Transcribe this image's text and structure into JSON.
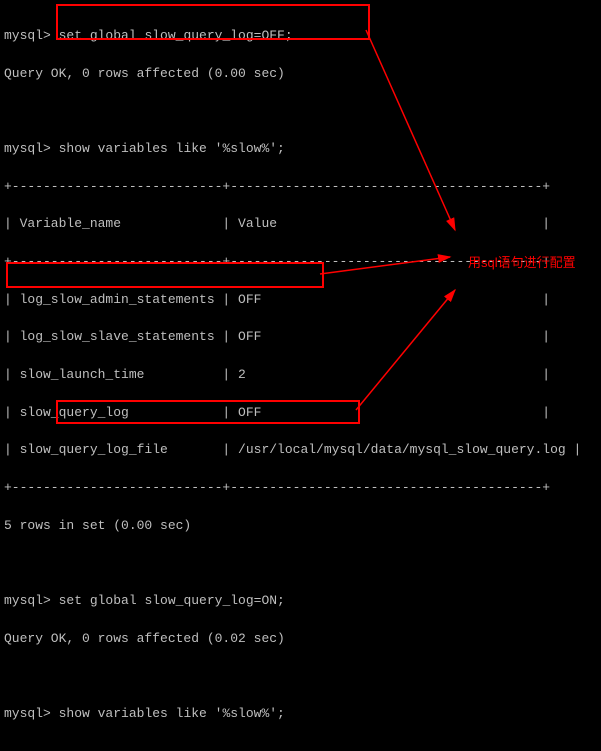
{
  "prompt": "mysql>",
  "cmd1": "set global slow_query_log=OFF;",
  "resp1": "Query OK, 0 rows affected (0.00 sec)",
  "cmd2": "show variables like '%slow%';",
  "sep_top": "+---------------------------+----------------------------------------+",
  "sep_mid": "+---------------------------+----------------------------------------+",
  "header": "| Variable_name             | Value                                  |",
  "row1": "| log_slow_admin_statements | OFF                                    |",
  "row2": "| log_slow_slave_statements | OFF                                    |",
  "row3": "| slow_launch_time          | 2                                      |",
  "row4": "| slow_query_log            | OFF                                    |",
  "row5a": "| slow_query_log_file       | /usr/local/mysql/data/mysql_slow_query.log |",
  "sep_bot": "+---------------------------+----------------------------------------+",
  "rows_msg": "5 rows in set (0.00 sec)",
  "cmd3": "set global slow_query_log=ON;",
  "resp3": "Query OK, 0 rows affected (0.02 sec)",
  "cmd4": "show variables like '%slow%';",
  "annotation_text": "用sql语句进行配置",
  "chart_data": {
    "type": "table",
    "title": "show variables like '%slow%'",
    "columns": [
      "Variable_name",
      "Value"
    ],
    "rows": [
      [
        "log_slow_admin_statements",
        "OFF"
      ],
      [
        "log_slow_slave_statements",
        "OFF"
      ],
      [
        "slow_launch_time",
        "2"
      ],
      [
        "slow_query_log",
        "OFF"
      ],
      [
        "slow_query_log_file",
        "/usr/local/mysql/data/mysql_slow_query.log"
      ]
    ],
    "row_count_msg": "5 rows in set (0.00 sec)"
  }
}
